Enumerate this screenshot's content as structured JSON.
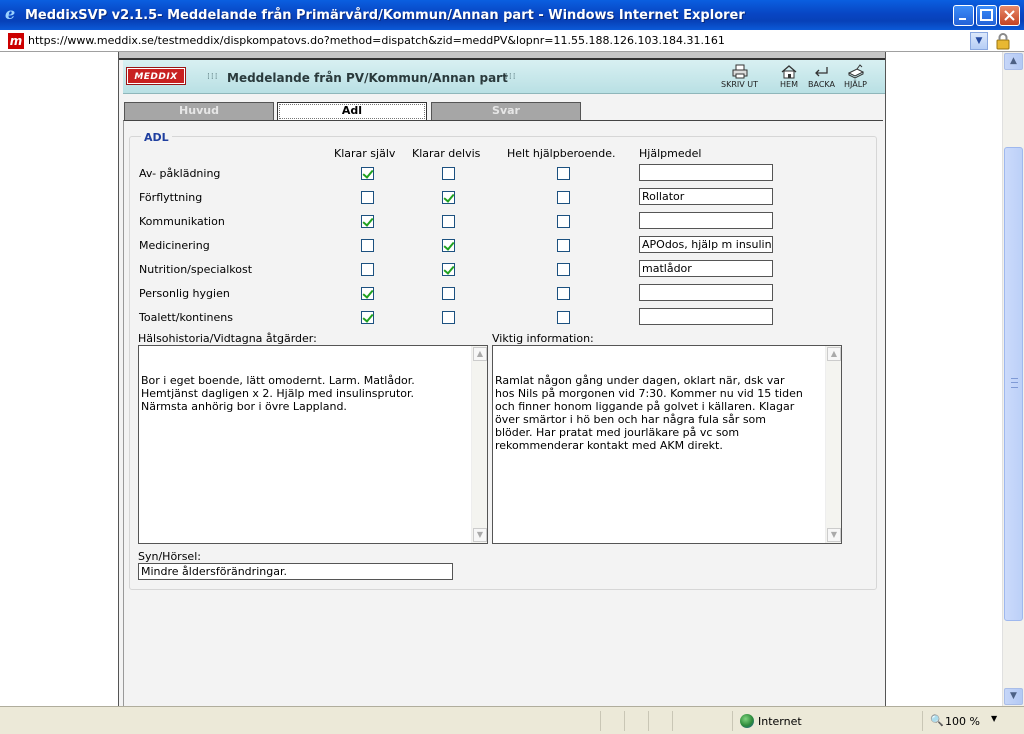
{
  "window": {
    "title": "MeddixSVP v2.1.5- Meddelande från Primärvård/Kommun/Annan part - Windows Internet Explorer",
    "url": "https://www.meddix.se/testmeddix/dispkompatovs.do?method=dispatch&zid=meddPV&lopnr=11.55.188.126.103.184.31.161",
    "site_icon": "m"
  },
  "header": {
    "logo": "MEDDIX",
    "title": "Meddelande från PV/Kommun/Annan part",
    "tools": {
      "print": "SKRIV UT",
      "home": "HEM",
      "back": "BACKA",
      "help": "HJÄLP"
    }
  },
  "tabs": [
    {
      "label": "Huvud",
      "active": false
    },
    {
      "label": "Adl",
      "active": true
    },
    {
      "label": "Svar",
      "active": false
    }
  ],
  "adl": {
    "legend": "ADL",
    "columns": {
      "self": "Klarar själv",
      "partial": "Klarar delvis",
      "dependent": "Helt hjälpberoende.",
      "aid": "Hjälpmedel"
    },
    "rows": [
      {
        "label": "Av- påklädning",
        "self": true,
        "partial": false,
        "dependent": false,
        "aid": ""
      },
      {
        "label": "Förflyttning",
        "self": false,
        "partial": true,
        "dependent": false,
        "aid": "Rollator"
      },
      {
        "label": "Kommunikation",
        "self": true,
        "partial": false,
        "dependent": false,
        "aid": ""
      },
      {
        "label": "Medicinering",
        "self": false,
        "partial": true,
        "dependent": false,
        "aid": "APOdos, hjälp m insulin"
      },
      {
        "label": "Nutrition/specialkost",
        "self": false,
        "partial": true,
        "dependent": false,
        "aid": "matlådor"
      },
      {
        "label": "Personlig hygien",
        "self": true,
        "partial": false,
        "dependent": false,
        "aid": ""
      },
      {
        "label": "Toalett/kontinens",
        "self": true,
        "partial": false,
        "dependent": false,
        "aid": ""
      }
    ]
  },
  "history": {
    "label": "Hälsohistoria/Vidtagna åtgärder:",
    "value": "Bor i eget boende, lätt omodernt. Larm. Matlådor.\nHemtjänst dagligen x 2. Hjälp med insulinsprutor.\nNärmsta anhörig bor i övre Lappland."
  },
  "important": {
    "label": "Viktig information:",
    "value": "Ramlat någon gång under dagen, oklart när, dsk var\nhos Nils på morgonen vid 7:30. Kommer nu vid 15 tiden\noch finner honom liggande på golvet i källaren. Klagar\növer smärtor i hö ben och har några fula sår som\nblöder. Har pratat med jourläkare på vc som\nrekommenderar kontakt med AKM direkt."
  },
  "vision": {
    "label": "Syn/Hörsel:",
    "value": "Mindre åldersförändringar."
  },
  "status": {
    "zone": "Internet",
    "zoom": "100 %"
  }
}
